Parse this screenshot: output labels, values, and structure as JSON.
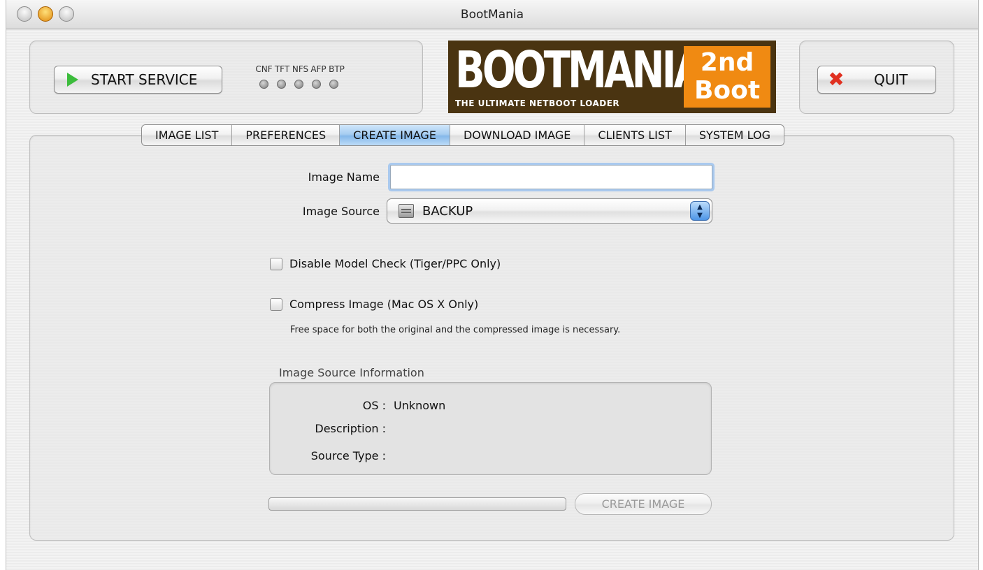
{
  "window": {
    "title": "BootMania"
  },
  "toolbar": {
    "start_label": "START SERVICE",
    "quit_label": "QUIT",
    "leds": [
      "CNF",
      "TFT",
      "NFS",
      "AFP",
      "BTP"
    ]
  },
  "logo": {
    "main_text": "BOOTMANIA",
    "sub_text": "THE ULTIMATE NETBOOT LOADER",
    "badge_line1": "2nd",
    "badge_line2": "Boot",
    "colors": {
      "background": "#4a3411",
      "badge": "#f08a12"
    }
  },
  "tabs": [
    {
      "label": "IMAGE LIST"
    },
    {
      "label": "PREFERENCES"
    },
    {
      "label": "CREATE IMAGE",
      "active": true
    },
    {
      "label": "DOWNLOAD IMAGE"
    },
    {
      "label": "CLIENTS LIST"
    },
    {
      "label": "SYSTEM LOG"
    }
  ],
  "form": {
    "image_name_label": "Image Name",
    "image_name_value": "",
    "image_source_label": "Image Source",
    "image_source_value": "BACKUP",
    "disable_model_check_label": "Disable Model Check (Tiger/PPC Only)",
    "compress_image_label": "Compress Image (Mac OS X Only)",
    "compress_note": "Free space for both the original and the compressed image is necessary."
  },
  "info": {
    "title": "Image Source Information",
    "os_label": "OS :",
    "os_value": "Unknown",
    "description_label": "Description :",
    "description_value": "",
    "source_type_label": "Source Type :",
    "source_type_value": ""
  },
  "actions": {
    "progress": 0,
    "create_label": "CREATE IMAGE"
  },
  "icons": {
    "start": "play-icon",
    "quit": "close-x-icon",
    "source": "disk-icon",
    "select": "up-down-arrows-icon"
  },
  "colors": {
    "accent": "#86b9ea",
    "start_icon": "#3cbc3c",
    "quit_icon": "#e03020"
  }
}
